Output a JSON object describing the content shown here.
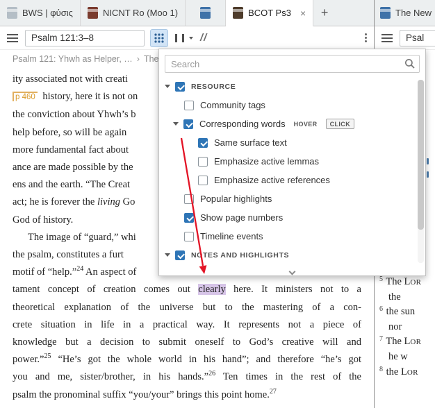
{
  "tabbar": {
    "left_tabs": [
      {
        "label": "BWS | φύσις",
        "active": false
      },
      {
        "label": "NICNT Ro (Moo 1)",
        "active": false
      },
      {
        "label": "",
        "active": false
      },
      {
        "label": "BCOT Ps3",
        "active": true
      }
    ],
    "close_glyph": "×",
    "new_tab_glyph": "+",
    "right_tab": {
      "label": "The New"
    }
  },
  "toolbar": {
    "reference_input": "Psalm 121:3–8",
    "slashes_icon": "//"
  },
  "right_toolbar": {
    "reference_input": "Psal"
  },
  "breadcrumb": {
    "first": "Psalm 121: Yhwh as Helper, …",
    "separator": "›",
    "second": "The"
  },
  "filter_popup": {
    "search_placeholder": "Search",
    "items": [
      {
        "label": "RESOURCE",
        "type": "section",
        "checked": true,
        "caret": true,
        "indent": 0
      },
      {
        "label": "Community tags",
        "checked": false,
        "caret": false,
        "indent": 1
      },
      {
        "label": "Corresponding words",
        "checked": true,
        "caret": true,
        "indent": 1,
        "badges": [
          {
            "label": "HOVER",
            "selected": false
          },
          {
            "label": "CLICK",
            "selected": true
          }
        ]
      },
      {
        "label": "Same surface text",
        "checked": true,
        "caret": false,
        "indent": 2
      },
      {
        "label": "Emphasize active lemmas",
        "checked": false,
        "caret": false,
        "indent": 2
      },
      {
        "label": "Emphasize active references",
        "checked": false,
        "caret": false,
        "indent": 2
      },
      {
        "label": "Popular highlights",
        "checked": false,
        "caret": false,
        "indent": 1
      },
      {
        "label": "Show page numbers",
        "checked": true,
        "caret": false,
        "indent": 1
      },
      {
        "label": "Timeline events",
        "checked": false,
        "caret": false,
        "indent": 1
      },
      {
        "label": "NOTES AND HIGHLIGHTS",
        "type": "section",
        "checked": true,
        "caret": true,
        "indent": 0
      }
    ]
  },
  "content": {
    "lines": [
      {
        "seg": [
          {
            "t": "ity associated not with creati"
          }
        ]
      },
      {
        "seg": [
          {
            "t": "p 460",
            "s": "page"
          },
          {
            "t": " history, here it is not on"
          }
        ]
      },
      {
        "seg": [
          {
            "t": "the conviction about Yhwh’s b"
          }
        ]
      },
      {
        "seg": [
          {
            "t": "help before, so will be again"
          }
        ]
      },
      {
        "seg": [
          {
            "t": "more fundamental fact about"
          }
        ]
      },
      {
        "seg": [
          {
            "t": "ance are made possible by the"
          }
        ]
      },
      {
        "seg": [
          {
            "t": "ens and the earth. “The Creat"
          }
        ]
      },
      {
        "seg": [
          {
            "t": "act; he is forever the "
          },
          {
            "t": "living",
            "s": "i"
          },
          {
            "t": " Go"
          }
        ]
      },
      {
        "seg": [
          {
            "t": "God of history."
          }
        ]
      },
      {
        "ind": true,
        "seg": [
          {
            "t": "The image of “guard,” whi"
          }
        ]
      },
      {
        "seg": [
          {
            "t": "the psalm, constitutes a furt"
          }
        ]
      },
      {
        "seg": [
          {
            "t": "motif of “help.”"
          },
          {
            "t": "24",
            "s": "sup"
          },
          {
            "t": " An aspect of"
          }
        ]
      },
      {
        "j": true,
        "seg": [
          {
            "t": "tament concept of creation comes out "
          },
          {
            "t": "clearly",
            "s": "hl"
          },
          {
            "t": " here. It ministers not to a"
          }
        ]
      },
      {
        "j": true,
        "seg": [
          {
            "t": "theoretical explanation of the universe but to the mastering of a con-"
          }
        ]
      },
      {
        "j": true,
        "seg": [
          {
            "t": "crete situation in life in a practical way. It represents not a piece of"
          }
        ]
      },
      {
        "j": true,
        "seg": [
          {
            "t": "knowledge but a decision to submit oneself to God’s creative will and"
          }
        ]
      },
      {
        "j": true,
        "seg": [
          {
            "t": "power.”"
          },
          {
            "t": "25",
            "s": "sup"
          },
          {
            "t": " “He’s got the whole world in his hand”; and therefore “he’s got"
          }
        ]
      },
      {
        "j": true,
        "seg": [
          {
            "t": "you and me, sister/brother, in his hands.”"
          },
          {
            "t": "26",
            "s": "sup"
          },
          {
            "t": " Ten times in the rest of the"
          }
        ]
      },
      {
        "seg": [
          {
            "t": "psalm the pronominal suffix “you/your” brings this point home."
          },
          {
            "t": "27",
            "s": "sup"
          }
        ]
      }
    ]
  },
  "right_panel": {
    "verses": [
      {
        "seg": [
          {
            "t": "5",
            "s": "sup"
          },
          {
            "t": " The L"
          },
          {
            "t": "or",
            "s": "sc"
          }
        ]
      },
      {
        "ind": true,
        "seg": [
          {
            "t": "the"
          }
        ]
      },
      {
        "seg": [
          {
            "t": "6",
            "s": "sup"
          },
          {
            "t": " the sun"
          }
        ]
      },
      {
        "ind": true,
        "seg": [
          {
            "t": "nor"
          }
        ]
      },
      {
        "seg": [
          {
            "t": "7",
            "s": "sup"
          },
          {
            "t": " The L"
          },
          {
            "t": "or",
            "s": "sc"
          }
        ]
      },
      {
        "ind": true,
        "seg": [
          {
            "t": "he w"
          }
        ]
      },
      {
        "seg": [
          {
            "t": "8",
            "s": "sup"
          },
          {
            "t": " the L"
          },
          {
            "t": "or",
            "s": "sc"
          }
        ]
      }
    ]
  },
  "annotation": {
    "color": "#e31426"
  },
  "colors": {
    "accent_blue": "#2e75b6",
    "filter_button_bg": "#d3e5f7",
    "highlight_lavender": "#d7c5e8",
    "page_marker_orange": "#d99a2b",
    "annotation_red": "#e31426"
  }
}
